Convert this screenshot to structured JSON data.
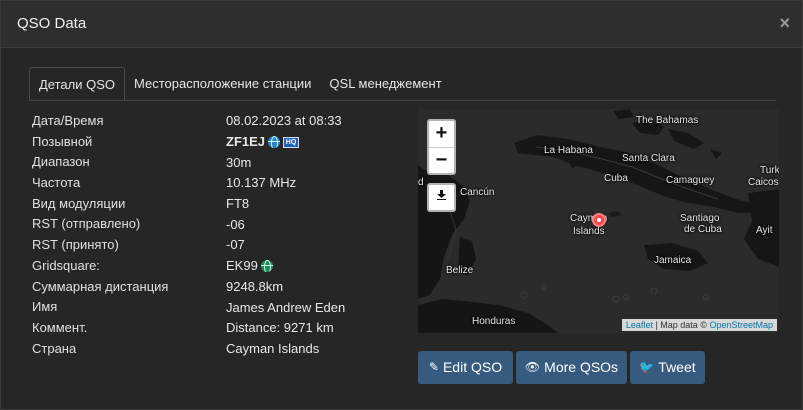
{
  "modal": {
    "title": "QSO Data",
    "close_glyph": "×"
  },
  "tabs": [
    {
      "label": "Детали QSO",
      "active": true
    },
    {
      "label": "Месторасположение станции",
      "active": false
    },
    {
      "label": "QSL менеджемент",
      "active": false
    }
  ],
  "details": {
    "datetime": {
      "label": "Дата/Время",
      "value": "08.02.2023 at 08:33"
    },
    "callsign": {
      "label": "Позывной",
      "value": "ZF1EJ",
      "badge": "HQ"
    },
    "band": {
      "label": "Диапазон",
      "value": "30m"
    },
    "frequency": {
      "label": "Частота",
      "value": "10.137 MHz"
    },
    "mode": {
      "label": "Вид модуляции",
      "value": "FT8"
    },
    "rst_sent": {
      "label": "RST (отправлено)",
      "value": "-06"
    },
    "rst_rcvd": {
      "label": "RST (принято)",
      "value": "-07"
    },
    "gridsquare": {
      "label": "Gridsquare:",
      "value": "EK99"
    },
    "distance": {
      "label": "Суммарная дистанция",
      "value": "9248.8km"
    },
    "name": {
      "label": "Имя",
      "value": "James Andrew Eden"
    },
    "comment": {
      "label": "Коммент.",
      "value": "Distance: 9271 km"
    },
    "country": {
      "label": "Страна",
      "value": "Cayman Islands"
    }
  },
  "map": {
    "zoom_in": "+",
    "zoom_out": "−",
    "labels": {
      "bahamas": "The Bahamas",
      "habana": "La Habana",
      "santa_clara": "Santa Clara",
      "cuba": "Cuba",
      "camaguey": "Camaguey",
      "turks": "Turk",
      "caicos": "Caicos",
      "cancun": "Cancún",
      "cayman": "Cayman",
      "islands": "Islands",
      "santiago": "Santiago",
      "de_cuba": "de Cuba",
      "ayiti": "Ayit",
      "jamaica": "Jamaica",
      "belize": "Belize",
      "honduras": "Honduras",
      "d_edge": "d"
    },
    "attribution": {
      "leaflet": "Leaflet",
      "sep": " | Map data © ",
      "osm": "OpenStreetMap"
    }
  },
  "buttons": {
    "edit": "Edit QSO",
    "more": "More QSOs",
    "tweet": "Tweet"
  },
  "colors": {
    "button": "#375a7f",
    "marker": "#f04a4a",
    "link": "#0078a8"
  }
}
